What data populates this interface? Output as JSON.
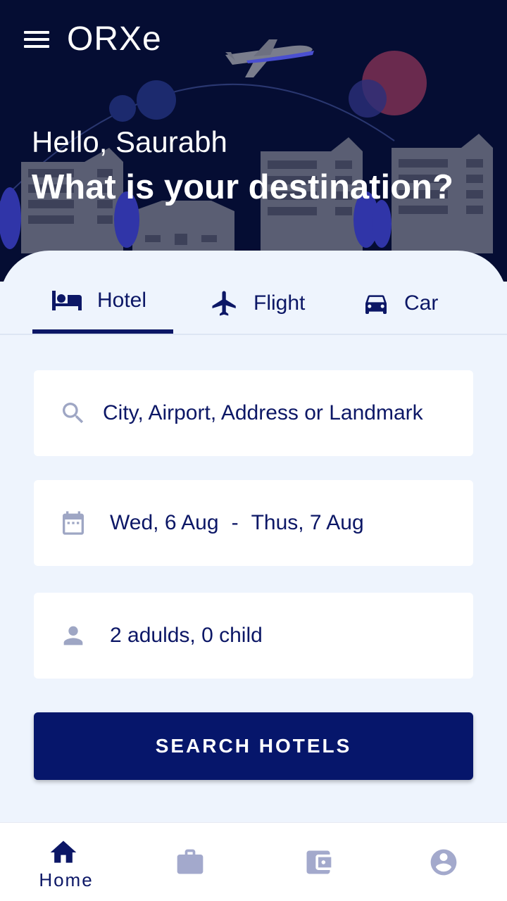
{
  "app": {
    "title": "ORXe",
    "greeting": "Hello, Saurabh",
    "question": "What is your destination?"
  },
  "tabs": [
    {
      "label": "Hotel",
      "icon": "bed-icon",
      "selected": true
    },
    {
      "label": "Flight",
      "icon": "airplane-icon",
      "selected": false
    },
    {
      "label": "Car",
      "icon": "car-icon",
      "selected": false
    }
  ],
  "form": {
    "location_placeholder": "City, Airport, Address or Landmark",
    "check_in": "Wed, 6 Aug",
    "separator": "-",
    "check_out": "Thus, 7 Aug",
    "guests": "2 adulds, 0 child",
    "search_button": "SEARCH HOTELS"
  },
  "bottom_nav": [
    {
      "label": "Home",
      "icon": "home-icon",
      "active": true
    },
    {
      "label": "",
      "icon": "briefcase-icon",
      "active": false
    },
    {
      "label": "",
      "icon": "wallet-icon",
      "active": false
    },
    {
      "label": "",
      "icon": "account-icon",
      "active": false
    }
  ],
  "colors": {
    "hero_bg": "#050d33",
    "primary": "#0c1766",
    "button_bg": "#06166b",
    "card_bg": "#eef4fd",
    "inactive_icon": "#a3a9cc",
    "field_icon": "#9ea6c4"
  }
}
